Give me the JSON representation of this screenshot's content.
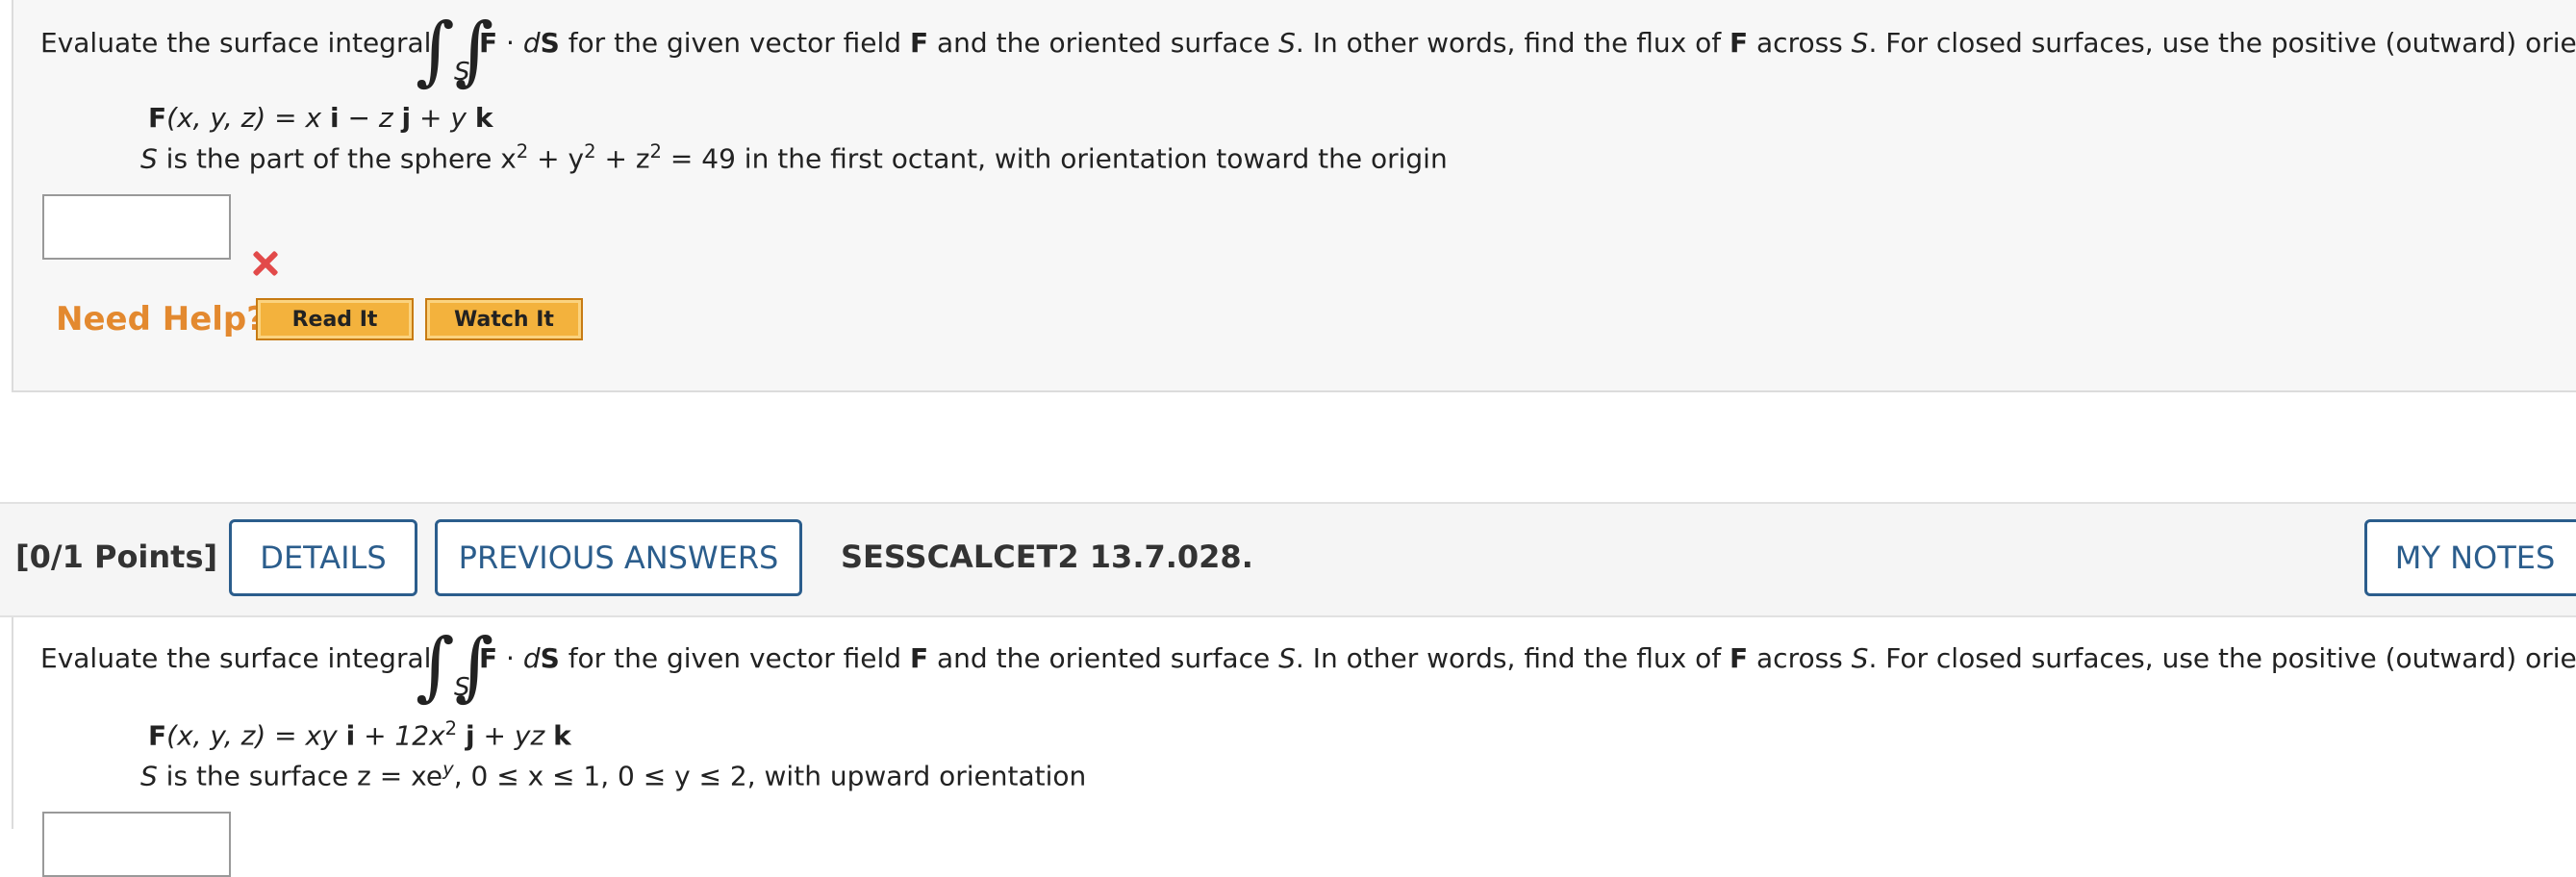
{
  "q1": {
    "intro": "Evaluate the surface integral",
    "integrand_F": "F",
    "integrand_dot": " · ",
    "integrand_d": "d",
    "integrand_S": "S",
    "subscript": "S",
    "rest_1": " for the given vector field ",
    "rest_F": "F",
    "rest_2": " and the oriented surface ",
    "rest_S": "S",
    "rest_3": ". In other words, find the flux of ",
    "rest_F2": "F",
    "rest_4": " across ",
    "rest_S2": "S",
    "rest_5": ". For closed surfaces, use the positive (outward) orientation.",
    "field": {
      "F": "F",
      "args": "(x, y, z) = x ",
      "i": "i",
      "mid": " − z ",
      "j": "j",
      "mid2": " + y ",
      "k": "k"
    },
    "surface": {
      "S": "S",
      "text1": " is the part of the sphere  x",
      "exp1": "2",
      "text2": " + y",
      "exp2": "2",
      "text3": " + z",
      "exp3": "2",
      "text4": " = 49  in the first octant, with orientation toward the origin"
    },
    "answer_value": "",
    "need_help": "Need Help?",
    "read_it": "Read It",
    "watch_it": "Watch It"
  },
  "q2_header": {
    "points": "[0/1 Points]",
    "details": "DETAILS",
    "previous_answers": "PREVIOUS ANSWERS",
    "code": "SESSCALCET2 13.7.028.",
    "my_notes": "MY NOTES"
  },
  "q2": {
    "intro": "Evaluate the surface integral",
    "integrand_F": "F",
    "integrand_dot": " · ",
    "integrand_d": "d",
    "integrand_S": "S",
    "subscript": "S",
    "rest_1": " for the given vector field ",
    "rest_F": "F",
    "rest_2": " and the oriented surface ",
    "rest_S": "S",
    "rest_3": ". In other words, find the flux of ",
    "rest_F2": "F",
    "rest_4": " across ",
    "rest_S2": "S",
    "rest_5": ". For closed surfaces, use the positive (outward) orientation.",
    "field": {
      "F": "F",
      "args": "(x, y, z) = xy ",
      "i": "i",
      "mid": " + 12x",
      "exp": "2",
      "sp": " ",
      "j": "j",
      "mid2": " + yz ",
      "k": "k"
    },
    "surface": {
      "S": "S",
      "text1": " is the surface  z = xe",
      "exp": "y",
      "text2": ", 0 ≤ x ≤ 1, 0 ≤ y ≤ 2,  with upward orientation"
    }
  },
  "colors": {
    "accent_blue": "#2b5d8c",
    "help_orange": "#e3892f",
    "error_red": "#e24a4a",
    "button_gold": "#f3b23d"
  },
  "icons": [
    "close-icon"
  ]
}
